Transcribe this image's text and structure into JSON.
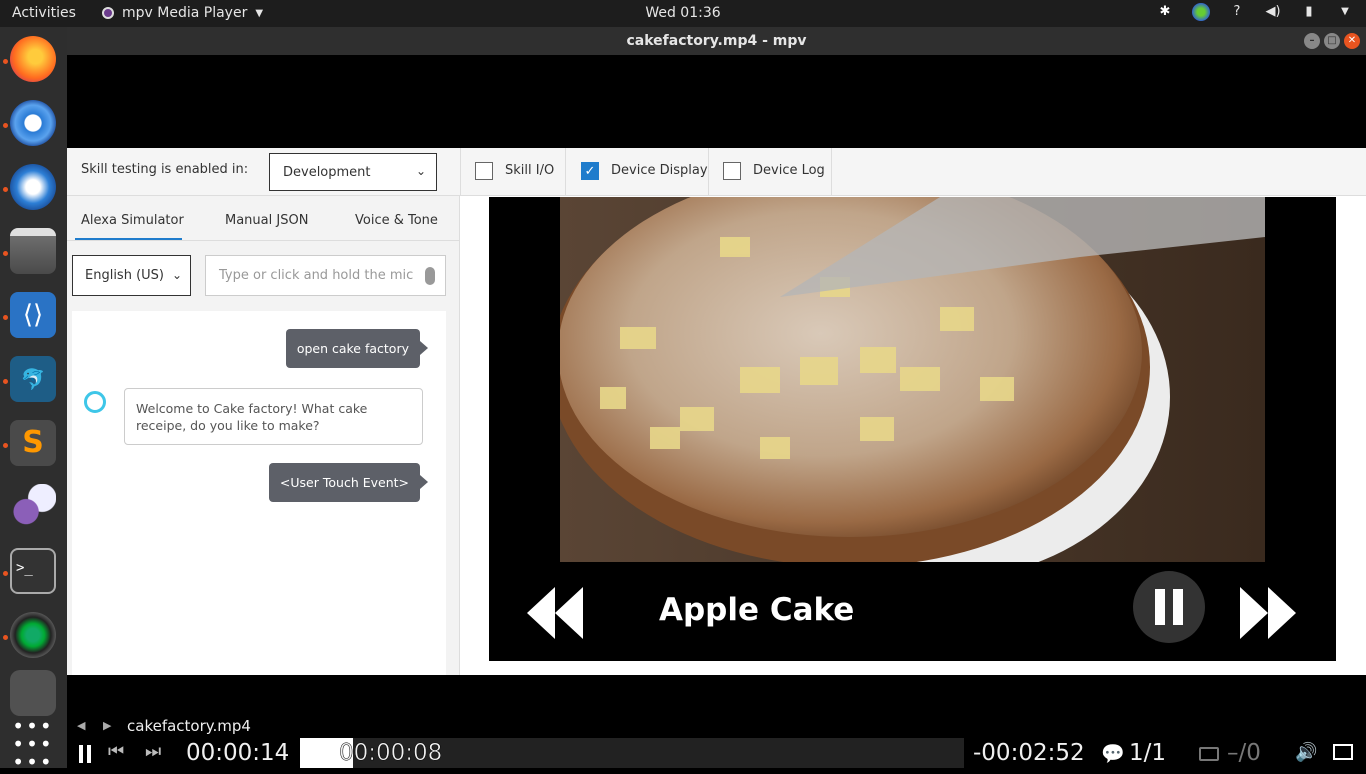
{
  "topbar": {
    "activities": "Activities",
    "app_name": "mpv Media Player",
    "clock": "Wed 01:36"
  },
  "window": {
    "title": "cakefactory.mp4 - mpv"
  },
  "console": {
    "skill_testing_label": "Skill testing is enabled in:",
    "stage_value": "Development",
    "checks": [
      {
        "label": "Skill I/O",
        "checked": false
      },
      {
        "label": "Device Display",
        "checked": true
      },
      {
        "label": "Device Log",
        "checked": false
      }
    ],
    "tabs": [
      "Alexa Simulator",
      "Manual JSON",
      "Voice & Tone"
    ],
    "language": "English (US)",
    "utterance_placeholder": "Type or click and hold the mic",
    "chat": [
      {
        "from": "user",
        "text": "open cake factory"
      },
      {
        "from": "alexa",
        "text": "Welcome to Cake factory! What cake receipe, do you like to make?"
      },
      {
        "from": "user",
        "text": "<User Touch Event>"
      }
    ],
    "display": {
      "title": "Apple Cake"
    }
  },
  "player": {
    "filename": "cakefactory.mp4",
    "elapsed": "00:00:14",
    "seek_time": "00:00:08",
    "remaining": "-00:02:52",
    "subs": "1/1",
    "audio": "–/0",
    "progress": 0.08
  },
  "colors": {
    "accent": "#1f7ccc",
    "dock_dot": "#e95420"
  }
}
